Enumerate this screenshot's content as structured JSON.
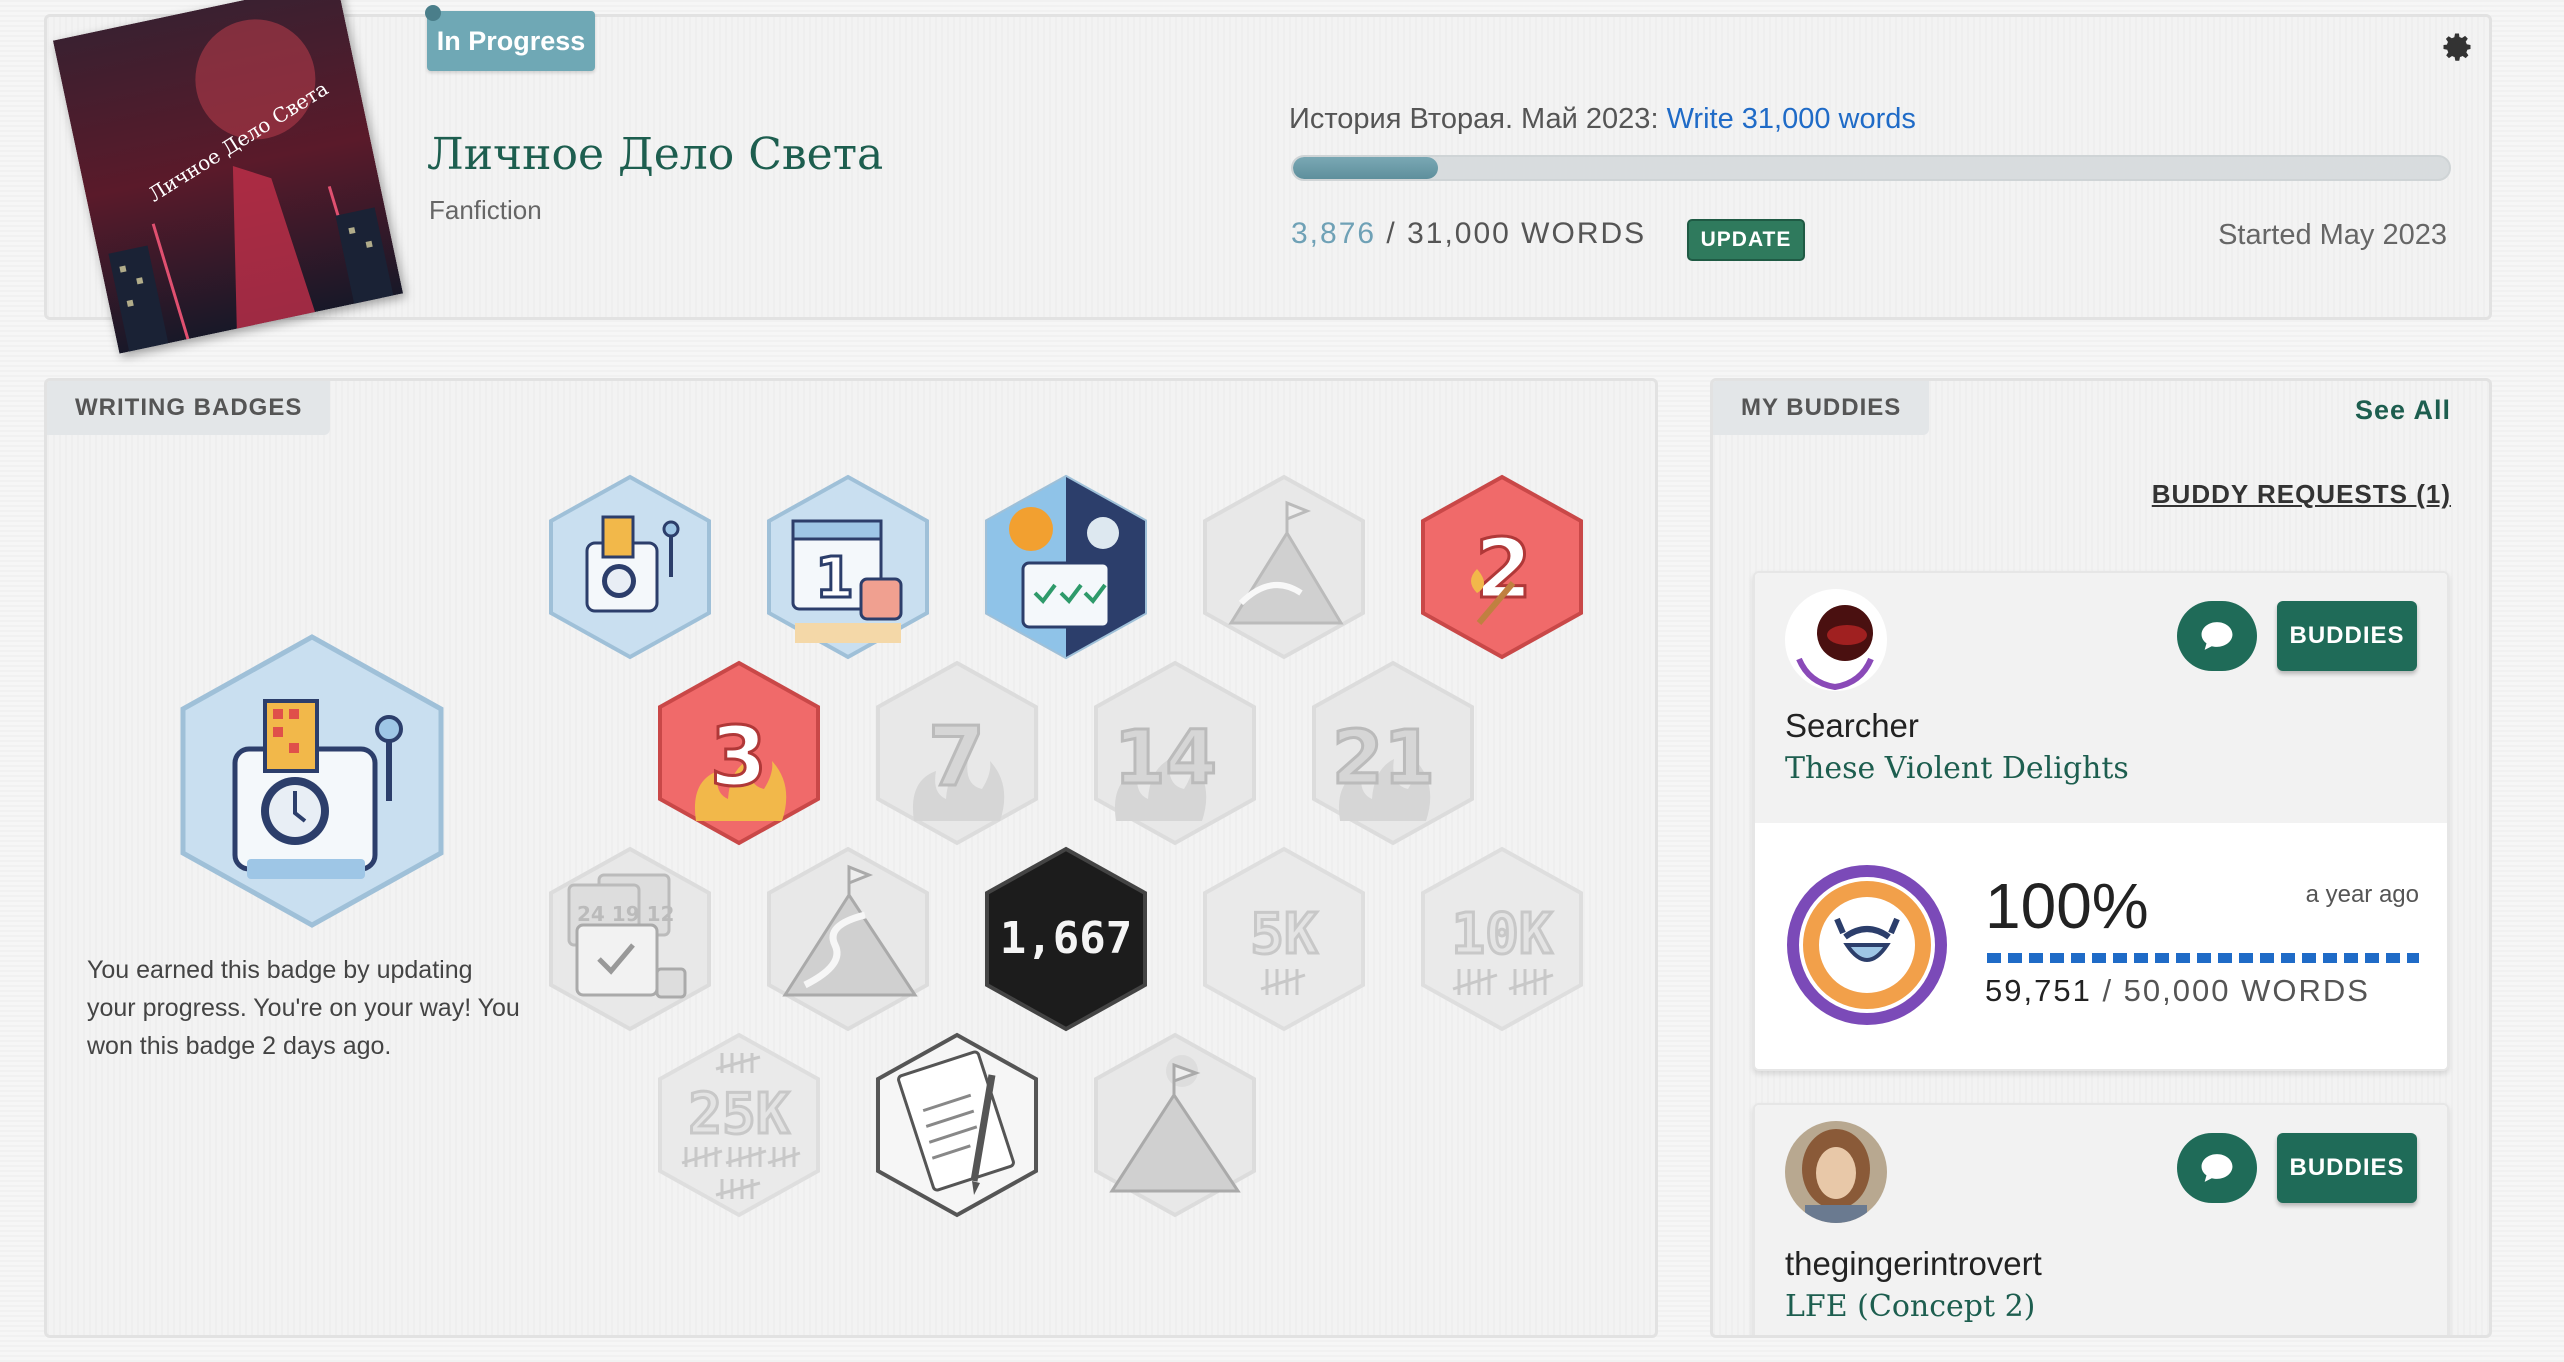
{
  "project": {
    "status": "In Progress",
    "title": "Личное Дело Света",
    "genre": "Fanfiction",
    "cover_text": "Личное Дело Света",
    "goal_prefix": "История Вторая. Май 2023: ",
    "goal_link": "Write 31,000 words",
    "progress_fraction": 0.125,
    "words_current": "3,876",
    "words_separator": " / ",
    "words_goal": "31,000 WORDS",
    "update_label": "UPDATE",
    "started": "Started May 2023",
    "settings_icon": "gear-icon"
  },
  "badges": {
    "tab_label": "WRITING BADGES",
    "detail_text": "You earned this badge by updating your progress. You're on your way! You won this badge 2 days ago.",
    "items": [
      {
        "label": "",
        "icon": "slot-machine-icon",
        "earned": true
      },
      {
        "label": "1",
        "icon": "calendar-mug-icon",
        "earned": true
      },
      {
        "label": "",
        "icon": "sun-calendar-icon",
        "earned": true
      },
      {
        "label": "",
        "icon": "mountain-flag-icon",
        "earned": false
      },
      {
        "label": "2",
        "icon": "match-flame-icon",
        "earned": true
      },
      {
        "label": "3",
        "icon": "flame-icon",
        "earned": true
      },
      {
        "label": "7",
        "icon": "flame-icon",
        "earned": false
      },
      {
        "label": "14",
        "icon": "flame-icon",
        "earned": false
      },
      {
        "label": "21",
        "icon": "flame-icon",
        "earned": false
      },
      {
        "label": "24 19 12",
        "icon": "calendar-stack-icon",
        "earned": false
      },
      {
        "label": "",
        "icon": "mountain-path-icon",
        "earned": false
      },
      {
        "label": "1,667",
        "icon": "chalkboard-icon",
        "earned": true
      },
      {
        "label": "5K",
        "icon": "tally-icon",
        "earned": false
      },
      {
        "label": "10K",
        "icon": "tally-icon",
        "earned": false
      },
      {
        "label": "25K",
        "icon": "tally-icon",
        "earned": false
      },
      {
        "label": "",
        "icon": "notebook-pen-icon",
        "earned": true
      },
      {
        "label": "",
        "icon": "summit-flag-icon",
        "earned": false
      }
    ]
  },
  "buddies": {
    "tab_label": "MY BUDDIES",
    "see_all": "See All",
    "requests": "BUDDY REQUESTS (1)",
    "button_label": "BUDDIES",
    "list": [
      {
        "name": "Searcher",
        "project": "These Violent Delights",
        "percent": "100%",
        "time": "a year ago",
        "words_current": "59,751",
        "words_separator": " / ",
        "words_goal": "50,000 WORDS",
        "ring_color": "#7b4ab8",
        "ring_inner": "#f2a04a"
      },
      {
        "name": "thegingerintrovert",
        "project": "LFE (Concept 2)"
      }
    ]
  },
  "colors": {
    "accent": "#1d5e4f",
    "button": "#1f6b58",
    "link": "#1f6bc7",
    "badge_red": "#f06a6a",
    "badge_blue": "#c9dff0"
  }
}
